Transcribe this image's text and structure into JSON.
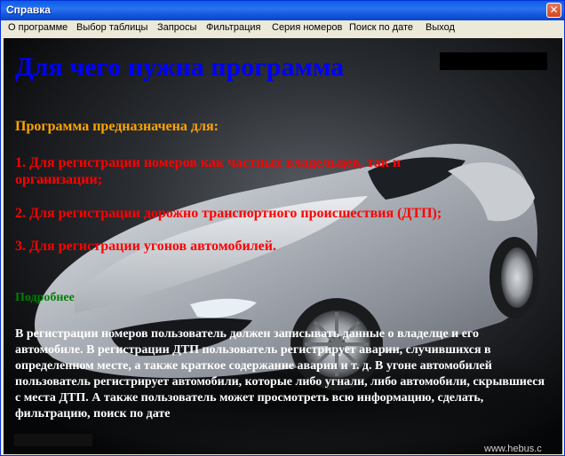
{
  "window": {
    "title": "Справка",
    "close_label": "✕"
  },
  "menu": {
    "items": [
      {
        "label": "О программе"
      },
      {
        "label": "Выбор таблицы"
      },
      {
        "label": "Запросы"
      },
      {
        "label": "Фильтрация"
      },
      {
        "label": "Серия номеров"
      },
      {
        "label": "Поиск по дате"
      },
      {
        "label": "Выход"
      }
    ]
  },
  "content": {
    "heading": "Для чего нужна программа",
    "intro": "Программа предназначена для:",
    "point1": "1. Для регистрации номеров как частных владельцев, так и организации;",
    "point2": "2. Для регистрации дорожно транспортного происшествия (ДТП);",
    "point3": "3. Для регистрации угонов автомобилей.",
    "more": "Подробнее",
    "description": "В регистрации номеров пользователь должен записывать данные о владелце и его автомобиле. В регистрации ДТП пользователь регистрирует аварии, случившихся в определенном месте, а также краткое содержание аварии и т. д. В угоне автомобилей пользователь регистрирует автомобили, которые либо угнали, либо автомобили, скрывшиеся с места ДТП. А также пользователь может просмотреть всю информацию, сделать, фильтрацию, поиск по дате",
    "watermark": "www.hebus.c"
  },
  "colors": {
    "heading": "#0000FF",
    "intro": "#FFA500",
    "points": "#FF0000",
    "more": "#008000",
    "description": "#FFFFFF",
    "titlebar": "#0A5FE6"
  }
}
